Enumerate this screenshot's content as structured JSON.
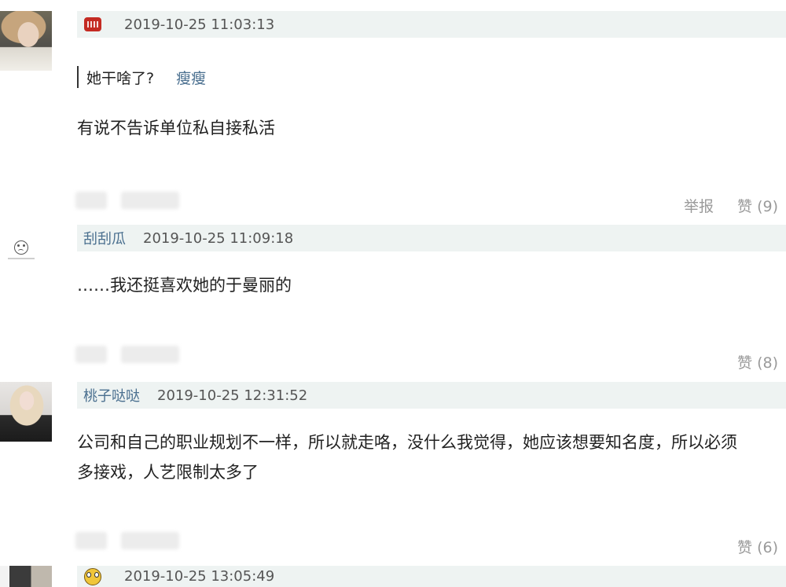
{
  "comments": [
    {
      "username": "",
      "time": "2019-10-25 11:03:13",
      "badge_icon": "phone-icon",
      "quote": {
        "text": "她干啥了?",
        "user": "瘦瘦"
      },
      "body": [
        "有说不告诉单位私自接私活"
      ],
      "actions": {
        "report": "举报",
        "like": "赞 (9)"
      }
    },
    {
      "username": "刮刮瓜",
      "time": "2019-10-25 11:09:18",
      "body": [
        "……我还挺喜欢她的于曼丽的"
      ],
      "actions": {
        "like": "赞 (8)"
      }
    },
    {
      "username": "桃子哒哒",
      "time": "2019-10-25 12:31:52",
      "body": [
        "公司和自己的职业规划不一样，所以就走咯，没什么我觉得，她应该想要知名度，所以必须",
        "多接戏，人艺限制太多了"
      ],
      "actions": {
        "like": "赞 (6)"
      }
    },
    {
      "username": "",
      "time": "2019-10-25 13:05:49",
      "badge_icon": "face-icon"
    }
  ]
}
